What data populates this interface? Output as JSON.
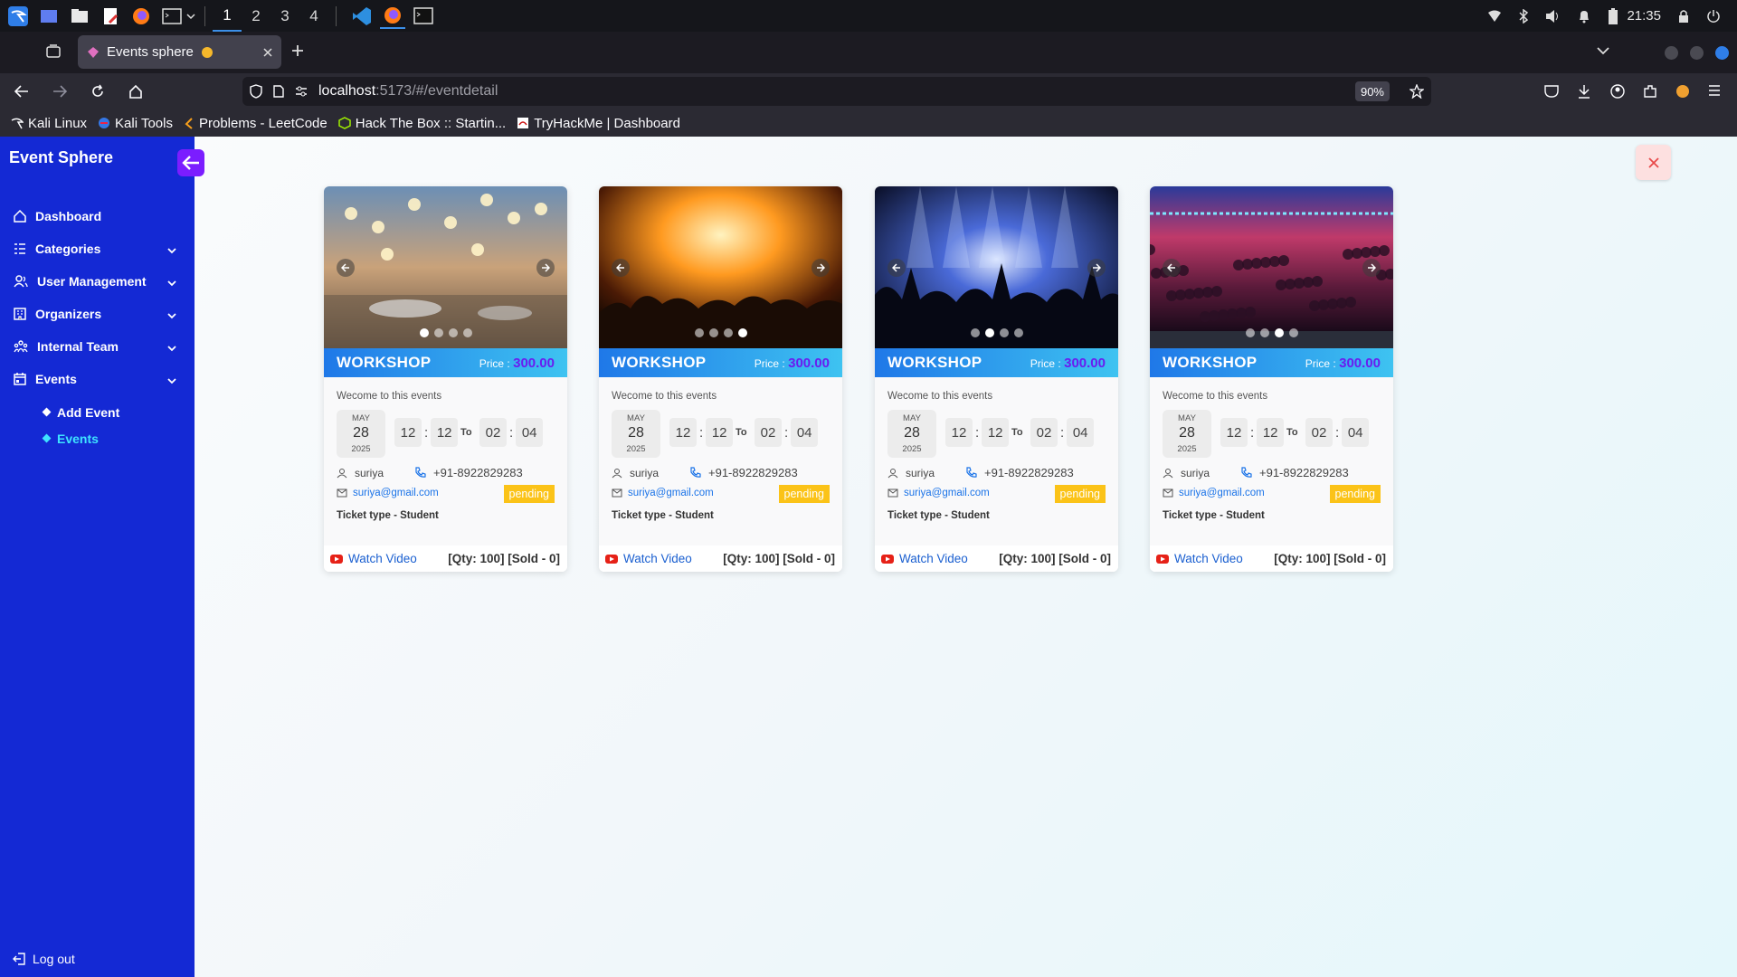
{
  "taskbar": {
    "workspaces": [
      "1",
      "2",
      "3",
      "4"
    ],
    "clock": "21:35"
  },
  "browser": {
    "tab_title": "Events sphere",
    "url_host": "localhost",
    "url_path": ":5173/#/eventdetail",
    "zoom": "90%",
    "bookmarks": [
      "Kali Linux",
      "Kali Tools",
      "Problems - LeetCode",
      "Hack The Box :: Startin...",
      "TryHackMe | Dashboard"
    ]
  },
  "sidebar": {
    "brand": "Event Sphere",
    "items": [
      {
        "label": "Dashboard",
        "icon": "home-icon"
      },
      {
        "label": "Categories",
        "icon": "list-icon"
      },
      {
        "label": "User Management",
        "icon": "users-icon"
      },
      {
        "label": "Organizers",
        "icon": "building-icon"
      },
      {
        "label": "Internal Team",
        "icon": "team-icon"
      },
      {
        "label": "Events",
        "icon": "calendar-icon"
      }
    ],
    "sub_items": [
      "Add Event",
      "Events"
    ],
    "logout": "Log out"
  },
  "cards": [
    {
      "title": "WORKSHOP",
      "price_label": "Price :",
      "price": "300.00",
      "welcome": "Wecome to this events",
      "month": "MAY",
      "day": "28",
      "year": "2025",
      "start_h": "12",
      "start_m": "12",
      "to": "To",
      "end_h": "02",
      "end_m": "04",
      "user": "suriya",
      "phone": "+91-8922829283",
      "email": "suriya@gmail.com",
      "status": "pending",
      "ticket": "Ticket type -  Student",
      "video": "Watch Video",
      "qty": "[Qty: 100] [Sold - 0]",
      "active_dot": 1
    },
    {
      "title": "WORKSHOP",
      "price_label": "Price :",
      "price": "300.00",
      "welcome": "Wecome to this events",
      "month": "MAY",
      "day": "28",
      "year": "2025",
      "start_h": "12",
      "start_m": "12",
      "to": "To",
      "end_h": "02",
      "end_m": "04",
      "user": "suriya",
      "phone": "+91-8922829283",
      "email": "suriya@gmail.com",
      "status": "pending",
      "ticket": "Ticket type -  Student",
      "video": "Watch Video",
      "qty": "[Qty: 100] [Sold - 0]",
      "active_dot": 4
    },
    {
      "title": "WORKSHOP",
      "price_label": "Price :",
      "price": "300.00",
      "welcome": "Wecome to this events",
      "month": "MAY",
      "day": "28",
      "year": "2025",
      "start_h": "12",
      "start_m": "12",
      "to": "To",
      "end_h": "02",
      "end_m": "04",
      "user": "suriya",
      "phone": "+91-8922829283",
      "email": "suriya@gmail.com",
      "status": "pending",
      "ticket": "Ticket type -  Student",
      "video": "Watch Video",
      "qty": "[Qty: 100] [Sold - 0]",
      "active_dot": 2
    },
    {
      "title": "WORKSHOP",
      "price_label": "Price :",
      "price": "300.00",
      "welcome": "Wecome to this events",
      "month": "MAY",
      "day": "28",
      "year": "2025",
      "start_h": "12",
      "start_m": "12",
      "to": "To",
      "end_h": "02",
      "end_m": "04",
      "user": "suriya",
      "phone": "+91-8922829283",
      "email": "suriya@gmail.com",
      "status": "pending",
      "ticket": "Ticket type -  Student",
      "video": "Watch Video",
      "qty": "[Qty: 100] [Sold - 0]",
      "active_dot": 3
    }
  ],
  "colors": {
    "sidebar": "#1429d4",
    "accent": "#7b1dff",
    "pending": "#fbc318",
    "active_sub": "#3ee3ff"
  }
}
